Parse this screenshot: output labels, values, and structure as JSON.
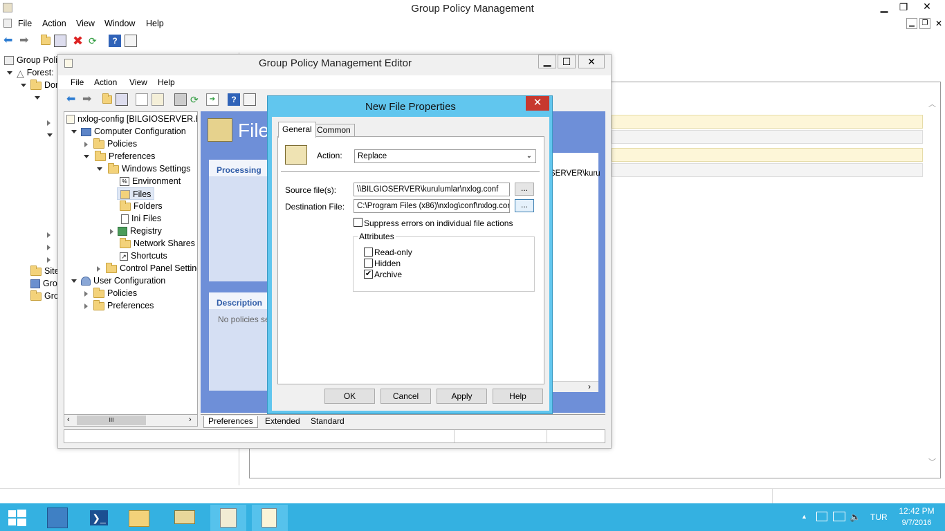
{
  "main_window": {
    "title": "Group Policy Management",
    "menu": [
      "File",
      "Action",
      "View",
      "Window",
      "Help"
    ],
    "tree": [
      "Group Poli",
      "Forest:",
      "Dor",
      "Site",
      "Gro",
      "Gro"
    ]
  },
  "editor": {
    "title": "Group Policy Management Editor",
    "menu": [
      "File",
      "Action",
      "View",
      "Help"
    ],
    "tree": {
      "root": "nxlog-config [BILGIOSERVER.BIL",
      "computer_config": "Computer Configuration",
      "policies": "Policies",
      "preferences": "Preferences",
      "windows_settings": "Windows Settings",
      "environment": "Environment",
      "files": "Files",
      "folders": "Folders",
      "ini_files": "Ini Files",
      "registry": "Registry",
      "network_shares": "Network Shares",
      "shortcuts": "Shortcuts",
      "control_panel": "Control Panel Setting",
      "user_config": "User Configuration",
      "user_policies": "Policies",
      "user_preferences": "Preferences"
    },
    "right": {
      "heading": "File",
      "processing": "Processing",
      "description": "Description",
      "no_policies": "No policies se",
      "path_peek": "SERVER\\kuru"
    },
    "bottom_tabs": [
      "Preferences",
      "Extended",
      "Standard"
    ],
    "scroll_thumb": "III"
  },
  "dialog": {
    "title": "New File Properties",
    "tabs": [
      "General",
      "Common"
    ],
    "action_label": "Action:",
    "action_value": "Replace",
    "source_label": "Source file(s):",
    "source_value": "\\\\BILGIOSERVER\\kurulumlar\\nxlog.conf",
    "dest_label": "Destination File:",
    "dest_value": "C:\\Program Files (x86)\\nxlog\\conf\\nxlog.conf",
    "browse": "...",
    "suppress_label": "Suppress errors on individual file actions",
    "attributes_title": "Attributes",
    "attr_readonly": "Read-only",
    "attr_hidden": "Hidden",
    "attr_archive": "Archive",
    "check_mark": "✔",
    "buttons": {
      "ok": "OK",
      "cancel": "Cancel",
      "apply": "Apply",
      "help": "Help"
    }
  },
  "taskbar": {
    "lang": "TUR",
    "time": "12:42 PM",
    "date": "9/7/2016"
  },
  "colors": {
    "dialog_frame": "#61c6ee",
    "taskbar": "#34b1e1",
    "close_red": "#c7382e",
    "editor_pane": "#6e8fd8"
  }
}
